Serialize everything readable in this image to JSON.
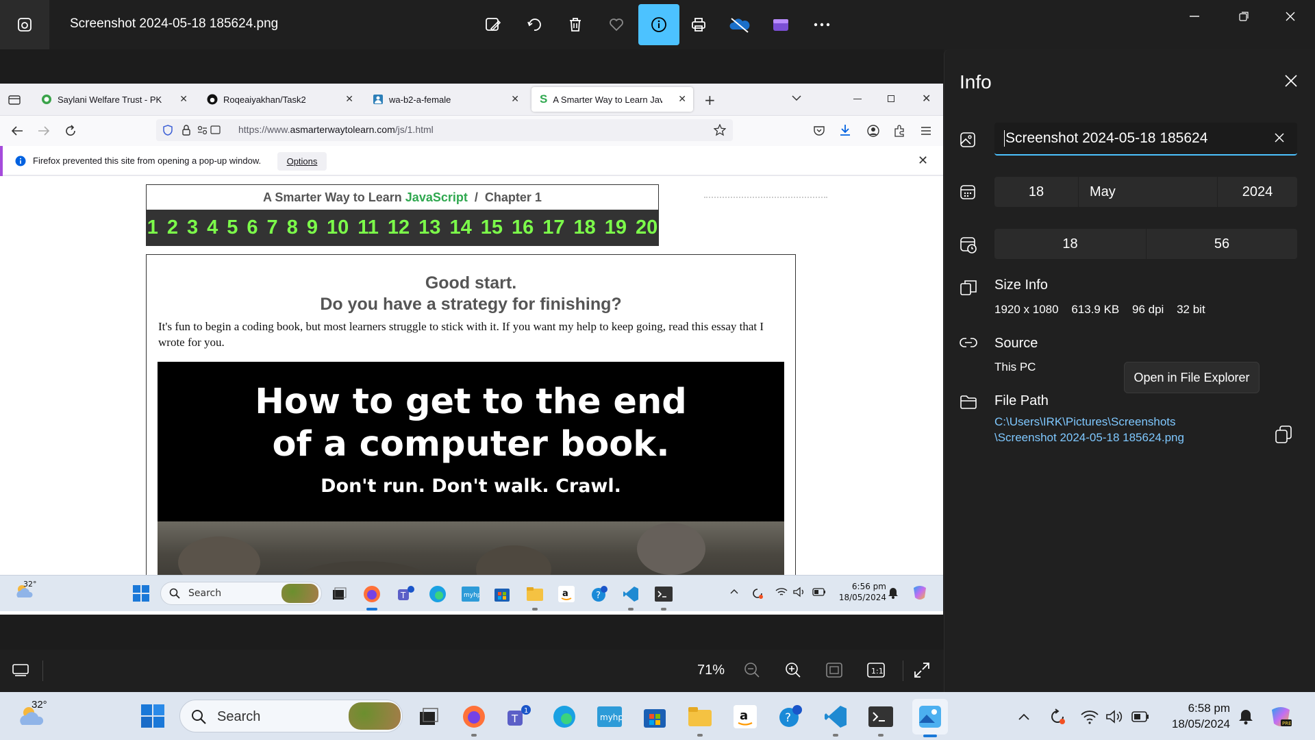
{
  "viewer": {
    "file_title": "Screenshot 2024-05-18 185624.png",
    "zoom": "71%"
  },
  "firefox": {
    "tabs": [
      {
        "label": "Saylani Welfare Trust - PK"
      },
      {
        "label": "Roqeaiyakhan/Task2"
      },
      {
        "label": "wa-b2-a-female"
      },
      {
        "label": "A Smarter Way to Learn JavaScript"
      }
    ],
    "url_prefix": "https://www.",
    "url_domain": "asmarterwaytolearn.com",
    "url_path": "/js/1.html",
    "notification": "Firefox prevented this site from opening a pop-up window.",
    "options_label": "Options"
  },
  "page": {
    "title_prefix": "A Smarter Way to Learn ",
    "title_js": "JavaScript",
    "title_sep": " / ",
    "title_chapter": "Chapter 1",
    "chapters": [
      "1",
      "2",
      "3",
      "4",
      "5",
      "6",
      "7",
      "8",
      "9",
      "10",
      "11",
      "12",
      "13",
      "14",
      "15",
      "16",
      "17",
      "18",
      "19",
      "20"
    ],
    "heading1": "Good start.",
    "heading2": "Do you have a strategy for finishing?",
    "essay": "It's fun to begin a coding book, but most learners struggle to stick with it. If you want my help to keep going, read this essay that I wrote for you.",
    "promo_line1": "How to get to the end",
    "promo_line2": "of a computer book.",
    "promo_sub": "Don't run. Don't walk. Crawl."
  },
  "inner_taskbar": {
    "temp": "32°",
    "search": "Search",
    "time": "6:56 pm",
    "date": "18/05/2024"
  },
  "info": {
    "title": "Info",
    "name_value": "Screenshot 2024-05-18 185624",
    "day": "18",
    "month": "May",
    "year": "2024",
    "hour": "18",
    "minute": "56",
    "size_label": "Size Info",
    "dimensions": "1920 x 1080",
    "filesize": "613.9 KB",
    "dpi": "96 dpi",
    "bits": "32 bit",
    "source_label": "Source",
    "source_value": "This PC",
    "tooltip": "Open in File Explorer",
    "path_label": "File Path",
    "path_line1": "C:\\Users\\IRK\\Pictures\\Screenshots",
    "path_line2": "\\Screenshot 2024-05-18 185624.png"
  },
  "taskbar": {
    "temp": "32°",
    "search": "Search",
    "time": "6:58 pm",
    "date": "18/05/2024"
  },
  "colors": {
    "accent": "#4cc2ff",
    "js_green": "#2fa84f",
    "chapter_green": "#7cfc4a",
    "link_blue": "#7fc8ff"
  }
}
